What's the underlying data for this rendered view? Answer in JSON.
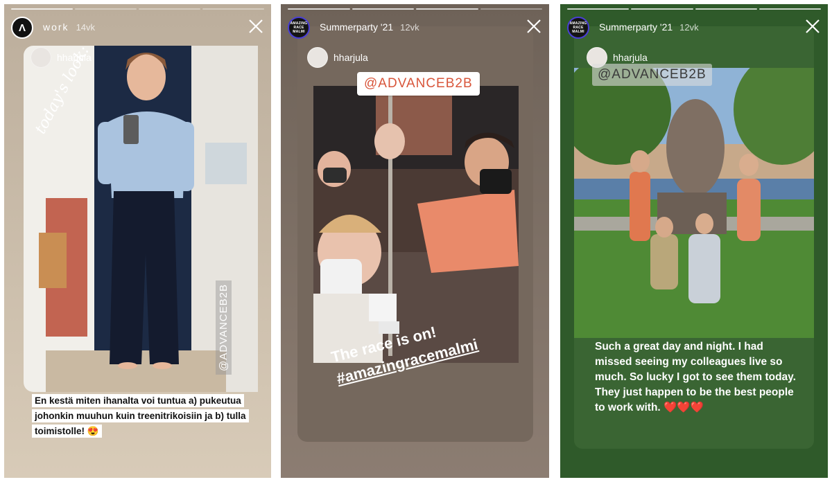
{
  "stories": [
    {
      "account": "work",
      "age": "14vk",
      "avatar_glyph": "Λ",
      "sub_user": "hharjula",
      "handwriting": "today's look:",
      "tag": "@ADVANCEB2B",
      "caption": "En kestä miten ihanalta voi tuntua a) pukeutua johonkin muuhun kuin treenitrikoisiin ja b) tulla toimistolle! 😍",
      "bg": "#c9b8a3"
    },
    {
      "account": "Summerparty '21",
      "age": "12vk",
      "avatar_text": "AMAZING RACE MALMI",
      "sub_user": "hharjula",
      "tag": "@ADVANCEB2B",
      "headline": "The race is on!",
      "hashtag": "#amazingracemalmi",
      "bg": "#6b5f55"
    },
    {
      "account": "Summerparty '21",
      "age": "12vk",
      "avatar_text": "AMAZING RACE MALMI",
      "sub_user": "hharjula",
      "tag": "@ADVANCEB2B",
      "caption": "Such a great day and night. I had missed seeing my colleagues live so much. So lucky I got to see them today. They just happen to be the best people to work with. ❤️❤️❤️",
      "bg": "#2f5a2a"
    }
  ],
  "colors": {
    "story3_bg": "#2f5a2a",
    "tag_gradient_start": "#e8603c",
    "tag_gradient_end": "#3b7bd9"
  }
}
